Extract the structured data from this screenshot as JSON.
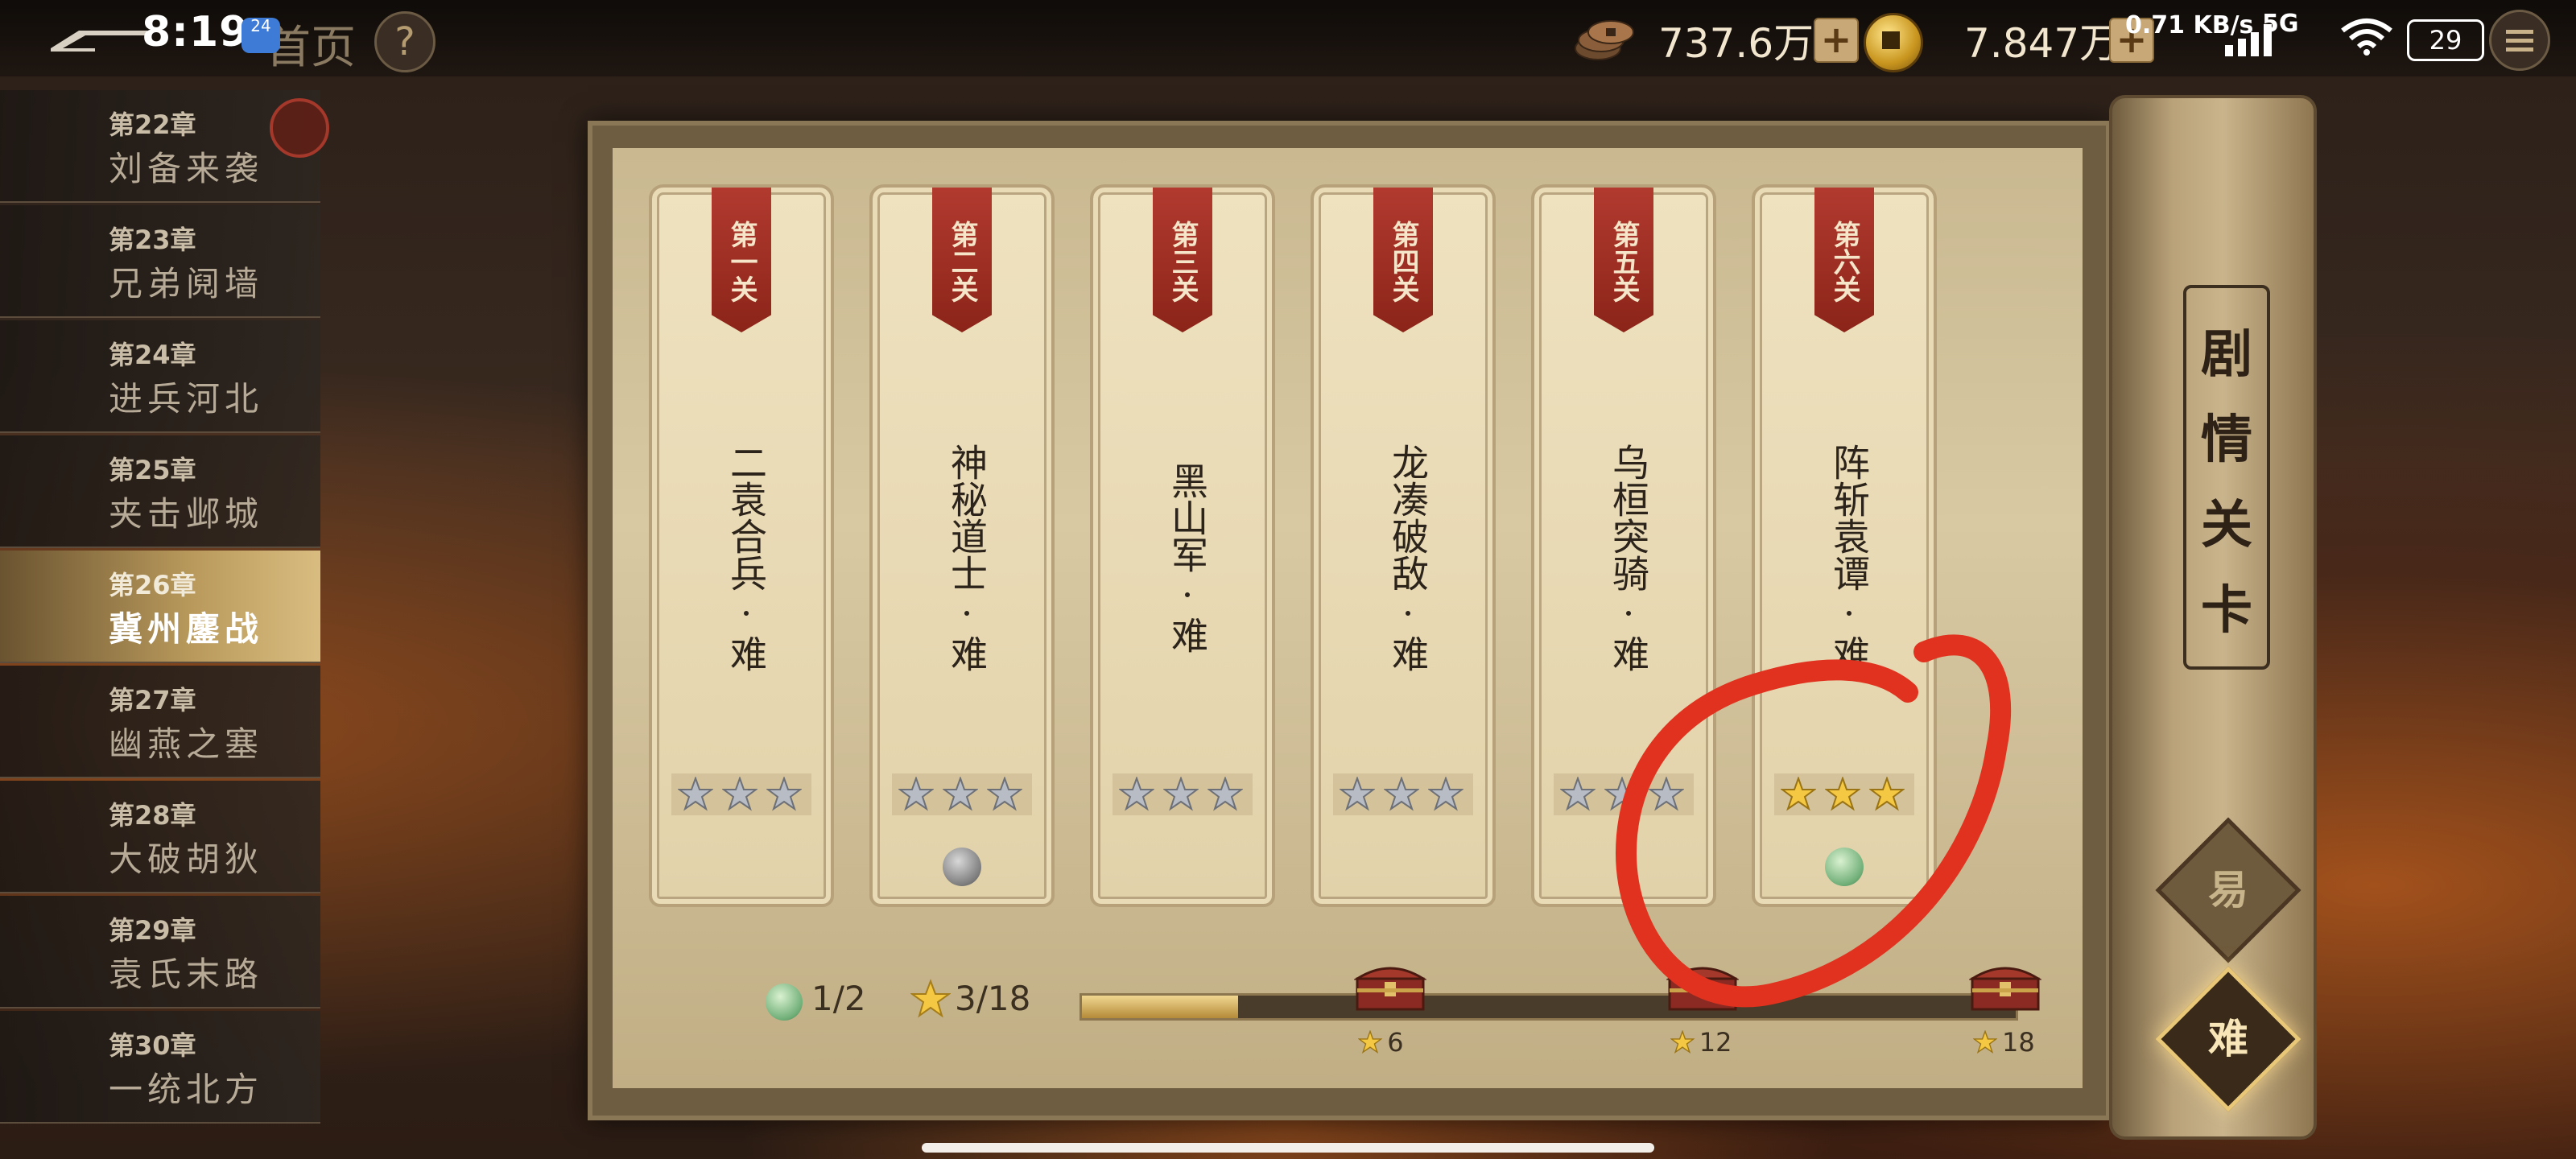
{
  "status_bar": {
    "time": "8:19",
    "notification_badge": "24",
    "network_speed": "0.71 KB/s",
    "network_5g_left": "5G",
    "network_5g_right": "5G",
    "battery": "29"
  },
  "topbar": {
    "home_label": "首页",
    "help_label": "?",
    "copper_value": "737.6万",
    "gold_value": "7.847万",
    "plus_label": "+"
  },
  "chapters": [
    {
      "num": "第22章",
      "title": "刘备来袭"
    },
    {
      "num": "第23章",
      "title": "兄弟阋墙"
    },
    {
      "num": "第24章",
      "title": "进兵河北"
    },
    {
      "num": "第25章",
      "title": "夹击邺城"
    },
    {
      "num": "第26章",
      "title": "冀州鏖战",
      "active": true
    },
    {
      "num": "第27章",
      "title": "幽燕之塞"
    },
    {
      "num": "第28章",
      "title": "大破胡狄"
    },
    {
      "num": "第29章",
      "title": "袁氏末路"
    },
    {
      "num": "第30章",
      "title": "一统北方"
    }
  ],
  "stages": [
    {
      "ribbon": "第一关",
      "name": "二袁合兵·难",
      "stars": 0,
      "orb": "none"
    },
    {
      "ribbon": "第二关",
      "name": "神秘道士·难",
      "stars": 0,
      "orb": "silver"
    },
    {
      "ribbon": "第三关",
      "name": "黑山军·难",
      "stars": 0,
      "orb": "none"
    },
    {
      "ribbon": "第四关",
      "name": "龙凑破敌·难",
      "stars": 0,
      "orb": "none"
    },
    {
      "ribbon": "第五关",
      "name": "乌桓突骑·难",
      "stars": 0,
      "orb": "none"
    },
    {
      "ribbon": "第六关",
      "name": "阵斩袁谭·难",
      "stars": 3,
      "orb": "jade"
    }
  ],
  "progress": {
    "orb_count": "1/2",
    "star_count": "3/18",
    "fill_fraction": 0.167,
    "milestones": [
      {
        "label": "6",
        "fraction": 0.333
      },
      {
        "label": "12",
        "fraction": 0.667
      },
      {
        "label": "18",
        "fraction": 1.0
      }
    ]
  },
  "spine": {
    "title": "剧情关卡",
    "easy_label": "易",
    "hard_label": "难"
  },
  "colors": {
    "ribbon": "#b23a2f",
    "star_gold": "#f4c842",
    "star_silver": "#b8bcc4",
    "annotation": "#e0321e"
  }
}
